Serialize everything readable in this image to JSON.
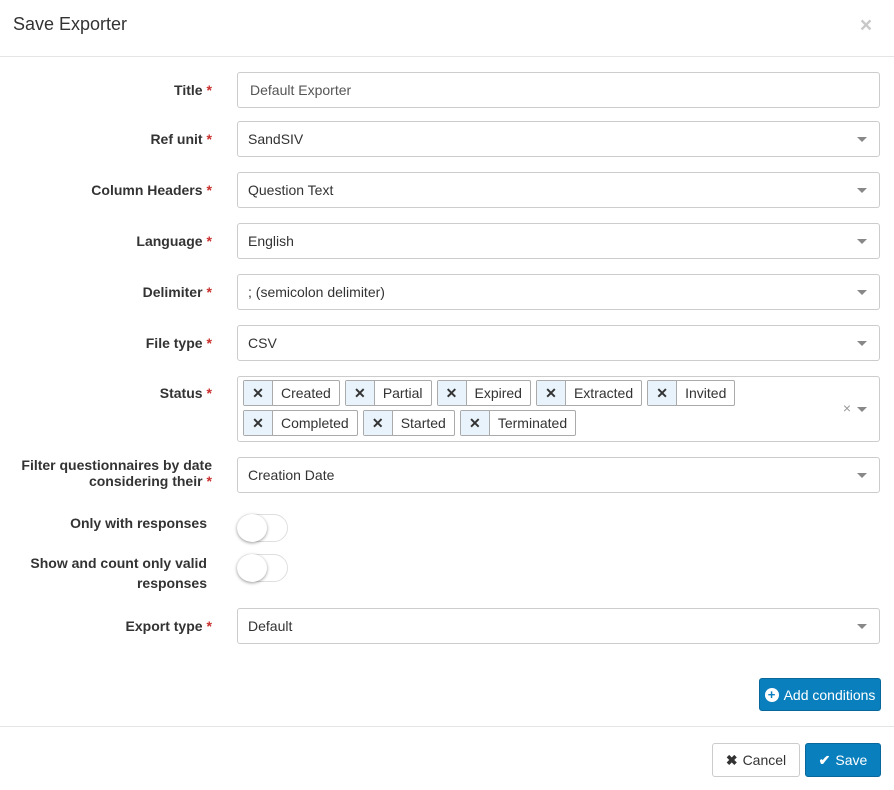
{
  "modal": {
    "title": "Save Exporter",
    "close_glyph": "×"
  },
  "required_marker": "*",
  "fields": {
    "title": {
      "label": "Title",
      "value": "Default Exporter"
    },
    "ref_unit": {
      "label": "Ref unit",
      "value": "SandSIV"
    },
    "column_headers": {
      "label": "Column Headers",
      "value": "Question Text"
    },
    "language": {
      "label": "Language",
      "value": "English"
    },
    "delimiter": {
      "label": "Delimiter",
      "value": "; (semicolon delimiter)"
    },
    "file_type": {
      "label": "File type",
      "value": "CSV"
    },
    "status": {
      "label": "Status",
      "tags": [
        "Created",
        "Partial",
        "Expired",
        "Extracted",
        "Invited",
        "Completed",
        "Started",
        "Terminated"
      ]
    },
    "filter_date": {
      "label": "Filter questionnaires by date considering their",
      "value": "Creation Date"
    },
    "only_responses": {
      "label": "Only with responses",
      "on": false
    },
    "valid_responses": {
      "label": "Show and count only valid responses",
      "on": false
    },
    "export_type": {
      "label": "Export type",
      "value": "Default"
    }
  },
  "buttons": {
    "add_conditions": "Add conditions",
    "cancel": "Cancel",
    "save": "Save"
  },
  "colors": {
    "primary": "#0a7fbd",
    "required": "#c9302c",
    "tag_bg": "#e8f3fb"
  },
  "icons": {
    "tag_remove": "✕",
    "cancel": "✖",
    "save": "✔",
    "add": "+"
  }
}
